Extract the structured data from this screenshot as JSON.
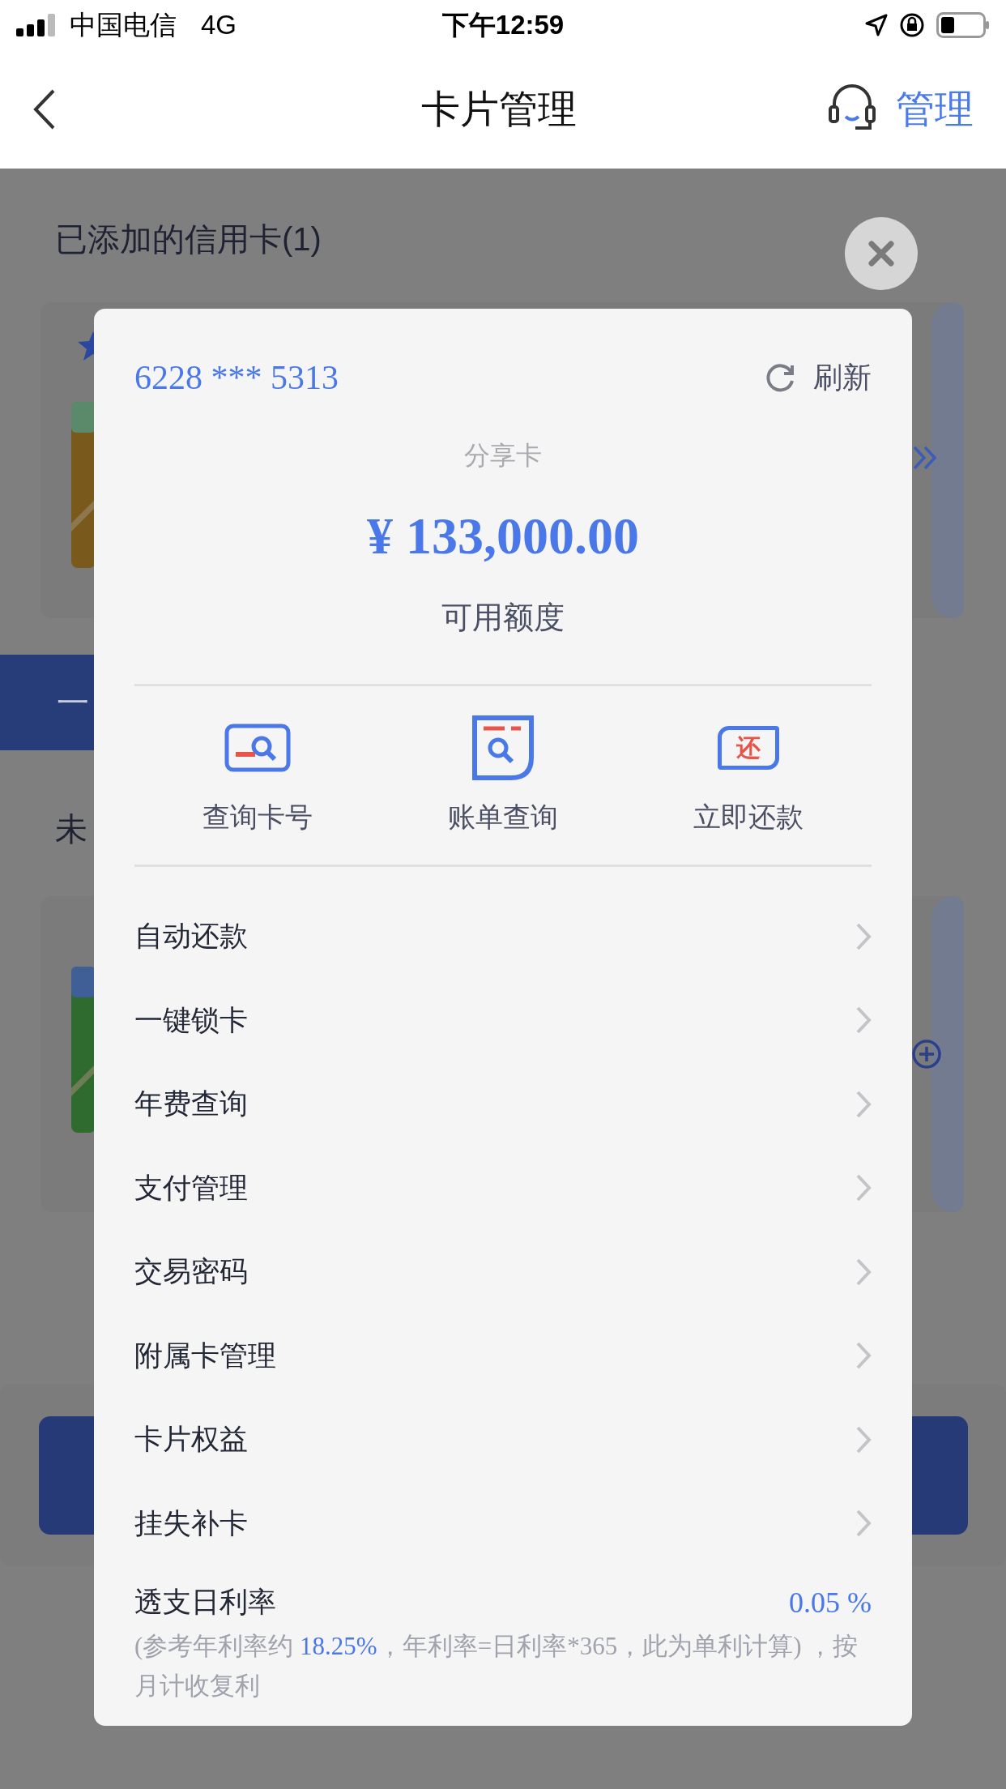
{
  "status_bar": {
    "carrier": "中国电信",
    "network": "4G",
    "time": "下午12:59"
  },
  "header": {
    "title": "卡片管理",
    "action": "管理"
  },
  "background": {
    "added_heading": "已添加的信用卡(1)",
    "bar_text": "一",
    "unadded_heading": "未"
  },
  "dialog": {
    "card_number": "6228 *** 5313",
    "refresh": "刷新",
    "card_type": "分享卡",
    "amount": "¥ 133,000.00",
    "amount_label": "可用额度",
    "actions": [
      {
        "kind": "card",
        "label": "查询卡号"
      },
      {
        "kind": "bill",
        "label": "账单查询"
      },
      {
        "kind": "repay",
        "label": "立即还款",
        "icon_text": "还"
      }
    ],
    "menu": [
      {
        "label": "自动还款"
      },
      {
        "label": "一键锁卡"
      },
      {
        "label": "年费查询"
      },
      {
        "label": "支付管理"
      },
      {
        "label": "交易密码"
      },
      {
        "label": "附属卡管理"
      },
      {
        "label": "卡片权益"
      },
      {
        "label": "挂失补卡"
      }
    ],
    "rate": {
      "label": "透支日利率",
      "value": "0.05 %",
      "note_before": "(参考年利率约 ",
      "note_highlight": "18.25%",
      "note_after": "，年利率=日利率*365，此为单利计算) ，按月计收复利"
    }
  }
}
